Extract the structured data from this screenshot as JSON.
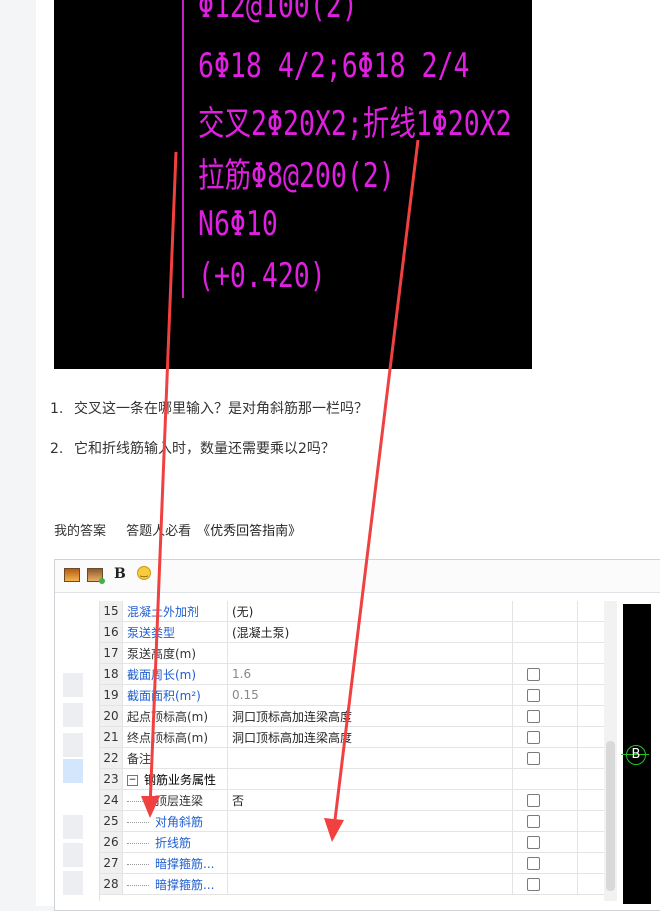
{
  "cad_lines": [
    "Φ12@100(2)",
    "6Φ18 4/2;6Φ18 2/4",
    "交叉2Φ20X2;折线1Φ20X2",
    "拉筋Φ8@200(2)",
    "N6Φ10",
    "(+0.420)"
  ],
  "questions": [
    {
      "num": "1.",
      "text": "交叉这一条在哪里输入？是对角斜筋那一栏吗？"
    },
    {
      "num": "2.",
      "text": "它和折线筋输入时，数量还需要乘以2吗？"
    }
  ],
  "answer_bar": {
    "my_answer": "我的答案",
    "must_read": "答题人必看",
    "guide": "《优秀回答指南》"
  },
  "toolbar": {
    "image_icon": "image-icon",
    "image_add_icon": "image-add-icon",
    "bold_label": "B",
    "emoji_icon": "emoji-icon"
  },
  "rows": [
    {
      "num": "15",
      "name": "混凝土外加剂",
      "value": "(无)",
      "check": false
    },
    {
      "num": "16",
      "name": "泵送类型",
      "value": "(混凝土泵)",
      "check": false
    },
    {
      "num": "17",
      "name": "泵送高度(m)",
      "value": "",
      "check": false
    },
    {
      "num": "18",
      "name": "截面周长(m)",
      "value": "1.6",
      "check": true
    },
    {
      "num": "19",
      "name": "截面面积(m²)",
      "value": "0.15",
      "check": true
    },
    {
      "num": "20",
      "name": "起点顶标高(m)",
      "value": "洞口顶标高加连梁高度",
      "check": true
    },
    {
      "num": "21",
      "name": "终点顶标高(m)",
      "value": "洞口顶标高加连梁高度",
      "check": true
    },
    {
      "num": "22",
      "name": "备注",
      "value": "",
      "check": true
    },
    {
      "num": "23",
      "name": "钢筋业务属性",
      "value": "",
      "check": false
    },
    {
      "num": "24",
      "name": "顶层连梁",
      "value": "否",
      "check": true
    },
    {
      "num": "25",
      "name": "对角斜筋",
      "value": "",
      "check": true
    },
    {
      "num": "26",
      "name": "折线筋",
      "value": "",
      "check": true
    },
    {
      "num": "27",
      "name": "暗撑箍筋...",
      "value": "",
      "check": true
    },
    {
      "num": "28",
      "name": "暗撑箍筋...",
      "value": "",
      "check": true
    }
  ],
  "side_badge": "B",
  "colors": {
    "cad_text": "#e020e0",
    "arrow": "#f04040",
    "link_blue": "#1f5fd1"
  }
}
